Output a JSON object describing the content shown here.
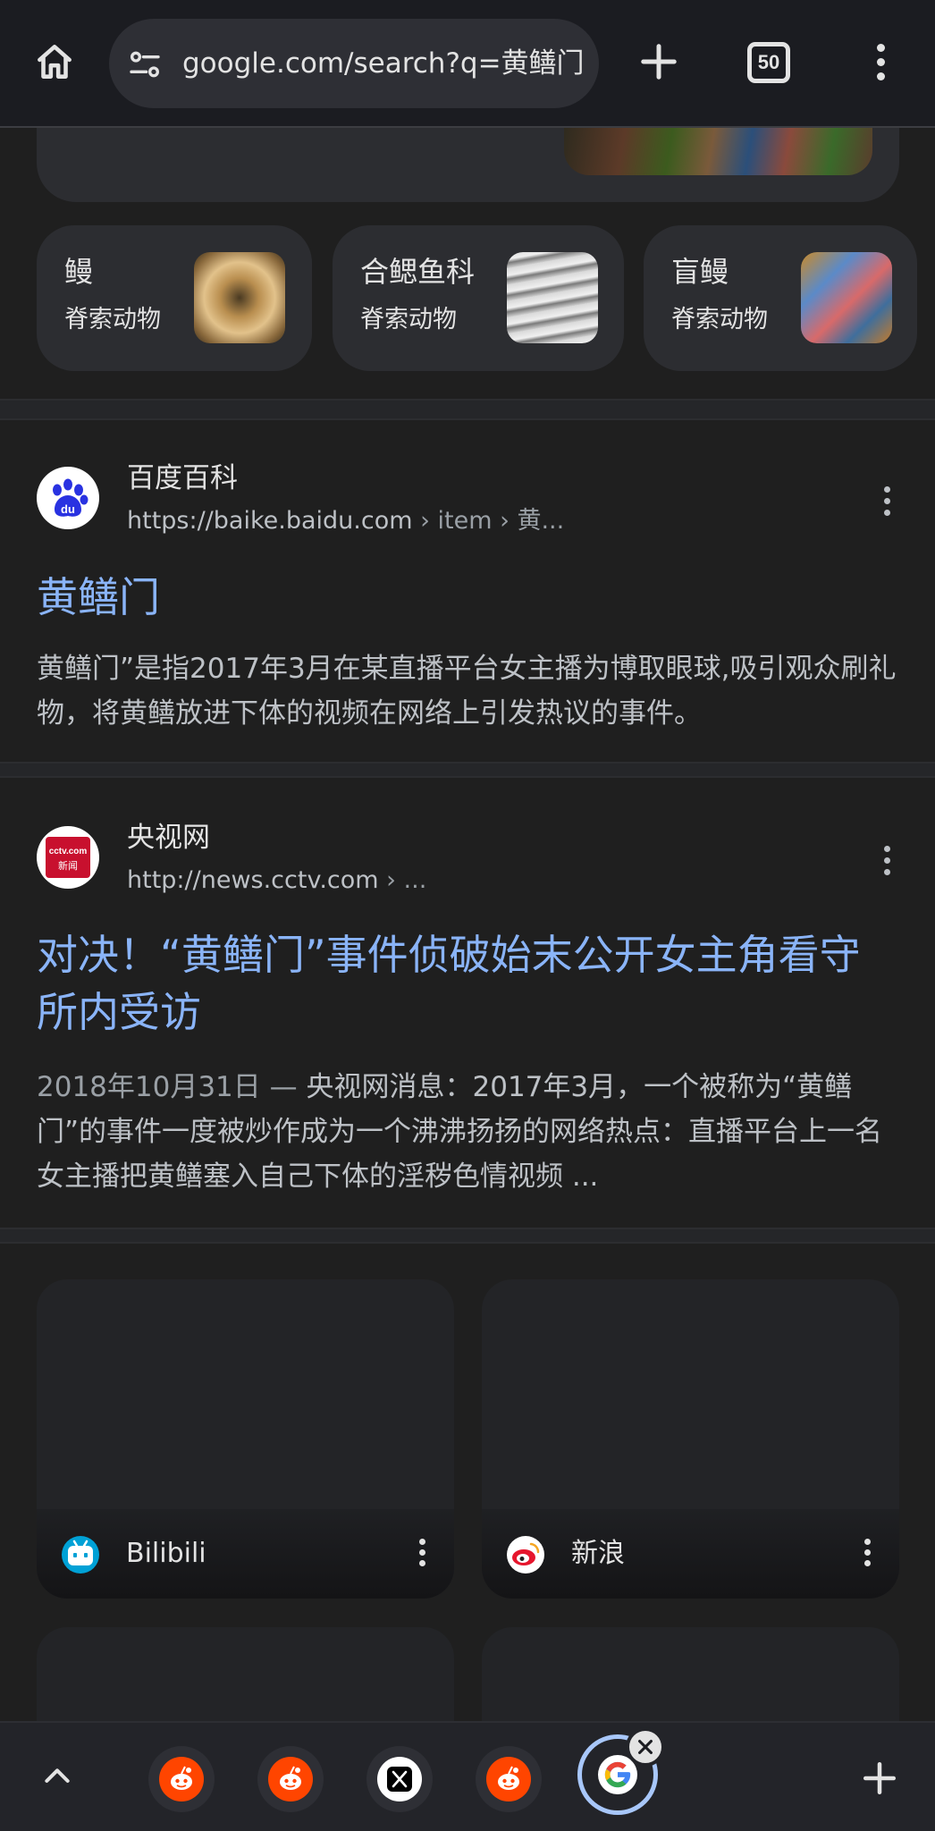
{
  "toolbar": {
    "url": "google.com/search?q=黄鳝门&",
    "tab_count": "50",
    "icons": [
      "home-icon",
      "site-settings-icon",
      "new-tab-icon",
      "tab-switcher-icon",
      "overflow-menu-icon"
    ]
  },
  "related_chips": [
    {
      "name": "鳗",
      "category": "脊索动物",
      "image": "eel-thumbnail"
    },
    {
      "name": "合鳃鱼科",
      "category": "脊索动物",
      "image": "swamp-eel-thumbnail"
    },
    {
      "name": "盲鳗",
      "category": "脊索动物",
      "image": "hagfish-thumbnail"
    }
  ],
  "results": [
    {
      "site_name": "百度百科",
      "url": "https://baike.baidu.com",
      "breadcrumb": " › item › 黄...",
      "favicon": "baidu-icon",
      "title": "黄鳝门",
      "date": "",
      "snippet": "黄鳝门”是指2017年3月在某直播平台女主播为博取眼球,吸引观众刷礼物，将黄鳝放进下体的视频在网络上引发热议的事件。"
    },
    {
      "site_name": "央视网",
      "url": "http://news.cctv.com",
      "breadcrumb": " › ...",
      "favicon": "cctv-news-icon",
      "favicon_text_top": "cctv.com",
      "favicon_text_bottom": "新闻",
      "title": "对决！“黄鳝门”事件侦破始末公开女主角看守所内受访",
      "date": "2018年10月31日 — ",
      "snippet": "央视网消息：2017年3月，一个被称为“黄鳝门”的事件一度被炒作成为一个沸沸扬扬的网络热点：直播平台上一名女主播把黄鳝塞入自己下体的淫秽色情视频 ..."
    }
  ],
  "grid_cards": [
    {
      "label": "Bilibili",
      "icon": "bilibili-icon"
    },
    {
      "label": "新浪",
      "icon": "weibo-icon"
    },
    {
      "label": "",
      "icon": ""
    },
    {
      "label": "",
      "icon": ""
    }
  ],
  "tab_strip": {
    "tabs": [
      {
        "icon": "reddit-icon"
      },
      {
        "icon": "reddit-icon"
      },
      {
        "icon": "x-icon"
      },
      {
        "icon": "reddit-icon"
      },
      {
        "icon": "google-icon",
        "active": true
      }
    ],
    "colors": {
      "reddit": "#ff4500",
      "active_ring": "#a8c7fa",
      "link": "#8ab4f8"
    }
  }
}
